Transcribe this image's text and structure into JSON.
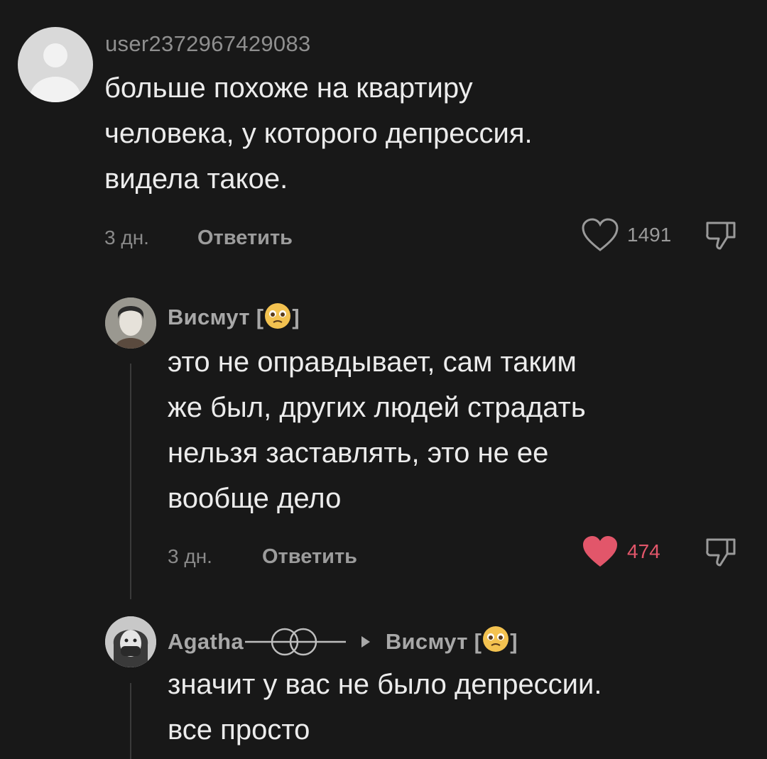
{
  "comments": [
    {
      "username": "user2372967429083",
      "text_lines": [
        "больше похоже на квартиру",
        "человека, у которого депрессия.",
        "видела такое."
      ],
      "time": "3 дн.",
      "reply_label": "Ответить",
      "likes": "1491",
      "liked": false
    },
    {
      "username": "Висмут [",
      "username_end": "]",
      "text_lines": [
        "это не оправдывает, сам таким",
        "же был, других людей страдать",
        "нельзя заставлять, это не ее",
        "вообще дело"
      ],
      "time": "3 дн.",
      "reply_label": "Ответить",
      "likes": "474",
      "liked": true
    },
    {
      "username": "Agatha",
      "reply_to": "Висмут [",
      "reply_to_end": "]",
      "text_lines": [
        "значит у вас не было депрессии.",
        "все просто"
      ]
    }
  ],
  "colors": {
    "background": "#181818",
    "like_active": "#e2566a"
  },
  "icons": {
    "like": "heart-outline-icon",
    "liked": "heart-filled-icon",
    "dislike": "thumbs-down-icon",
    "reply_arrow": "triangle-right-icon",
    "username_emoji": "pleading-face-emoji"
  }
}
